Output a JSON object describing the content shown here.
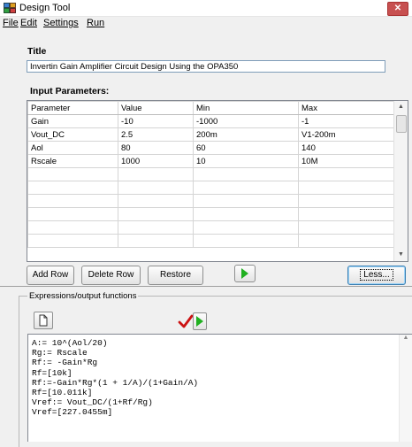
{
  "window": {
    "title": "Design Tool",
    "close_label": "✕"
  },
  "menu": [
    "File",
    "Edit",
    "Settings",
    "Run"
  ],
  "title_section": {
    "heading": "Title",
    "value": "Invertin Gain Amplifier Circuit Design Using the OPA350"
  },
  "input_params": {
    "heading": "Input Parameters:",
    "columns": [
      "Parameter",
      "Value",
      "Min",
      "Max"
    ],
    "rows": [
      [
        "Gain",
        "-10",
        "-1000",
        "-1"
      ],
      [
        "Vout_DC",
        "2.5",
        "200m",
        "V1-200m"
      ],
      [
        "Aol",
        "80",
        "60",
        "140"
      ],
      [
        "Rscale",
        "1000",
        "10",
        "10M"
      ]
    ],
    "empty_rows": 6
  },
  "buttons": {
    "add_row": "Add Row",
    "delete_row": "Delete Row",
    "restore": "Restore",
    "less": "Less..."
  },
  "expressions": {
    "group_label": "Expressions/output functions",
    "lines": [
      "A:= 10^(Aol/20)",
      "Rg:= Rscale",
      "Rf:= -Gain*Rg",
      "Rf=[10k]",
      "Rf:=-Gain*Rg*(1 + 1/A)/(1+Gain/A)",
      "Rf=[10.011k]",
      "Vref:= Vout_DC/(1+Rf/Rg)",
      "Vref=[227.0455m]"
    ]
  },
  "colors": {
    "run_arrow": "#20b020",
    "check_mark": "#cc1111",
    "close_button": "#c75050"
  },
  "icons": {
    "app": "design-tool-icon",
    "run": "run-play-icon",
    "check": "check-icon",
    "new": "new-page-icon"
  }
}
